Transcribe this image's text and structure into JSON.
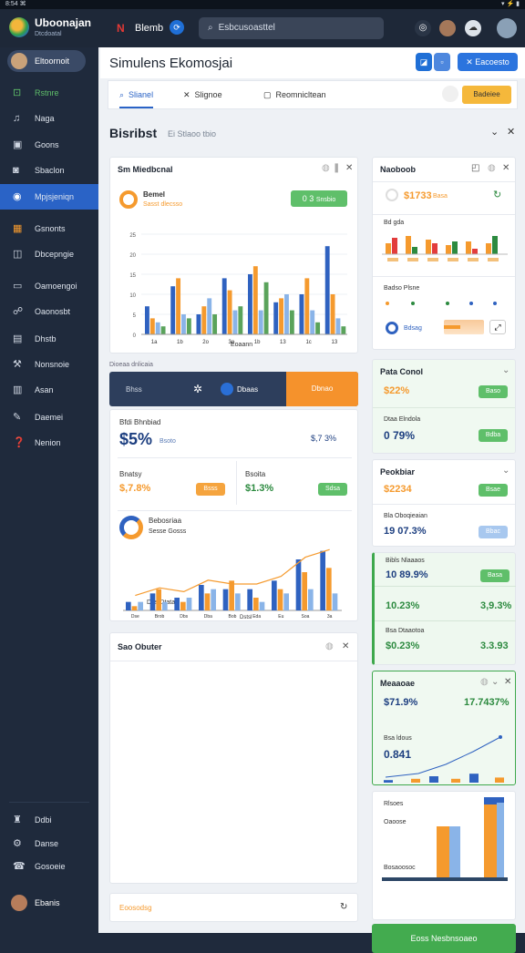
{
  "status": {
    "time": "8:54 ⌘",
    "icons": "▾ ⚡ ▮"
  },
  "app": {
    "title": "Uboonajan",
    "subtitle": "Dtcdoatal"
  },
  "topbar": {
    "brand_letter": "N",
    "brand_label": "Blemb",
    "search_placeholder": "Esbcusoasttel"
  },
  "sidebar": {
    "profile": "Eltoornoit",
    "items": [
      {
        "label": "Rstnre",
        "icon": "home-icon",
        "glyph": "⊡",
        "active": false,
        "green": true
      },
      {
        "label": "Naga",
        "icon": "chart-icon",
        "glyph": "♫",
        "active": false
      },
      {
        "label": "Goons",
        "icon": "calendar-icon",
        "glyph": "▣",
        "active": false
      },
      {
        "label": "Sbaclon",
        "icon": "inbox-icon",
        "glyph": "◙",
        "active": false
      },
      {
        "label": "Mpjsjeniqn",
        "icon": "globe-icon",
        "glyph": "◉",
        "active": true
      },
      {
        "label": "Gsnonts",
        "icon": "grid-icon",
        "glyph": "▦",
        "active": false,
        "orange": true
      },
      {
        "label": "Dbcepngie",
        "icon": "shield-icon",
        "glyph": "◫",
        "active": false
      },
      {
        "label": "Oamoengoi",
        "icon": "window-icon",
        "glyph": "▭",
        "active": false
      },
      {
        "label": "Oaonosbt",
        "icon": "link-icon",
        "glyph": "☍",
        "active": false
      },
      {
        "label": "Dhstb",
        "icon": "doc-icon",
        "glyph": "▤",
        "active": false
      },
      {
        "label": "Nonsnoie",
        "icon": "tools-icon",
        "glyph": "⚒",
        "active": false
      },
      {
        "label": "Asan",
        "icon": "book-icon",
        "glyph": "▥",
        "active": false
      },
      {
        "label": "Daemei",
        "icon": "pen-icon",
        "glyph": "✎",
        "active": false
      },
      {
        "label": "Nenion",
        "icon": "help-icon",
        "glyph": "❓",
        "active": false
      }
    ],
    "bottom": [
      {
        "label": "Ddbi",
        "icon": "puzzle-icon",
        "glyph": "♜"
      },
      {
        "label": "Danse",
        "icon": "gear-icon",
        "glyph": "⚙"
      },
      {
        "label": "Gosoeie",
        "icon": "support-icon",
        "glyph": "☎"
      }
    ],
    "user": "Ebanis"
  },
  "header": {
    "title": "Simulens Ekomosjai",
    "btn_new": "Eacoesto"
  },
  "tabs": [
    {
      "label": "Slianel",
      "icon": "search-icon",
      "glyph": "⌕"
    },
    {
      "label": "Slignoe",
      "icon": "close-icon",
      "glyph": "✕"
    },
    {
      "label": "Reomnicltean",
      "icon": "stop-icon",
      "glyph": "▢"
    }
  ],
  "tab_action": "Badeiee",
  "section": {
    "title": "Bisribst",
    "subtitle": "Ei Stlaoo tbio"
  },
  "card1": {
    "title": "Sm Miedbcnal",
    "kpi_title": "Bemel",
    "kpi_sub": "Sasst dlecsso",
    "badge": "0 3",
    "badge_label": "Snsbio",
    "xlabel": "Eoaann"
  },
  "chart_data": [
    {
      "type": "bar",
      "title": "Sm Miedbcnal",
      "categories": [
        "1a",
        "1b",
        "2o",
        "3o",
        "1b",
        "13",
        "1c",
        "13"
      ],
      "series": [
        {
          "color": "#2f62c0",
          "values": [
            7,
            12,
            5,
            14,
            15,
            8,
            10,
            22
          ]
        },
        {
          "color": "#f59a2e",
          "values": [
            4,
            14,
            7,
            11,
            17,
            9,
            14,
            10
          ]
        },
        {
          "color": "#8ab4e8",
          "values": [
            3,
            5,
            9,
            6,
            6,
            10,
            6,
            4
          ]
        },
        {
          "color": "#5aa35b",
          "values": [
            2,
            4,
            5,
            7,
            13,
            6,
            3,
            2
          ]
        }
      ],
      "ylim": [
        0,
        25
      ]
    },
    {
      "type": "bar",
      "title": "Dbs Dtatae",
      "categories": [
        "Dse",
        "Brob",
        "Dbs",
        "Dba",
        "Bob",
        "Eda",
        "Eu",
        "Soa",
        "3a"
      ],
      "series": [
        {
          "color": "#2f62c0",
          "values": [
            2,
            4,
            3,
            6,
            5,
            5,
            7,
            12,
            14
          ]
        },
        {
          "color": "#f59a2e",
          "values": [
            1,
            5,
            2,
            4,
            7,
            3,
            5,
            9,
            10
          ]
        },
        {
          "color": "#8ab4e8",
          "values": [
            2,
            2,
            3,
            5,
            4,
            2,
            4,
            5,
            4
          ]
        }
      ]
    }
  ],
  "banner": {
    "left": "Bhss",
    "mid": "Dbaas",
    "right": "Dbnao"
  },
  "banner_label": "Dioeaa dnlicaia",
  "card2": {
    "title": "Bfdi Bhnbiad",
    "kpi": "$5%",
    "kpi_sub": "Bsoto",
    "kpi_right": "$,7 3%",
    "m1_label": "Bnatsy",
    "m1_val": "$,7.8%",
    "m1_pill": "Bsss",
    "m2_label": "Bsoita",
    "m2_val": "$1.3%",
    "m2_pill": "Sdsa",
    "donut_title": "Bebosriaa",
    "donut_sub": "Sesse Gosss",
    "chart_title": "Dbs Dtatae",
    "chart_x": "Dstsl"
  },
  "card3": {
    "title": "Sao Obuter"
  },
  "card4": {
    "title": "Eoosodsg"
  },
  "r1": {
    "title": "Naoboob",
    "kpi": "$1733",
    "kpi_sub": "Basa",
    "mini_title": "Bd gda",
    "leg_title": "Badso Plsne",
    "leg2": "Bdsag"
  },
  "r2": {
    "title": "Pata Conol",
    "kpi": "$22%",
    "pill": "Baso",
    "sub": "Dtaa Elndola",
    "kpi2": "0 79%",
    "pill2": "Bdba"
  },
  "r3": {
    "title": "Peokbiar",
    "kpi": "$2234",
    "pill": "Bsae",
    "sub": "Bla Oboqieaian",
    "kpi2": "19 07.3%",
    "pill2": "Bbac"
  },
  "r4": {
    "title": "Bibls Nlaaaos",
    "v1": "10 89.9%",
    "p1": "Basa",
    "v2": "10.23%",
    "v2b": "3,9.3%",
    "sub": "Bsa Dtaaotoa",
    "v3": "$0.23%",
    "v3b": "3.3.93"
  },
  "r5": {
    "title": "Meaaoae",
    "v1": "$71.9%",
    "v1b": "17.7437%",
    "sub": "Bsa ldous",
    "v2": "0.841"
  },
  "r6": {
    "t1": "Rlsoes",
    "t2": "Oaoose",
    "t3": "Bosaoosoc",
    "btn": "Eoss Nesbnsoaeo"
  }
}
